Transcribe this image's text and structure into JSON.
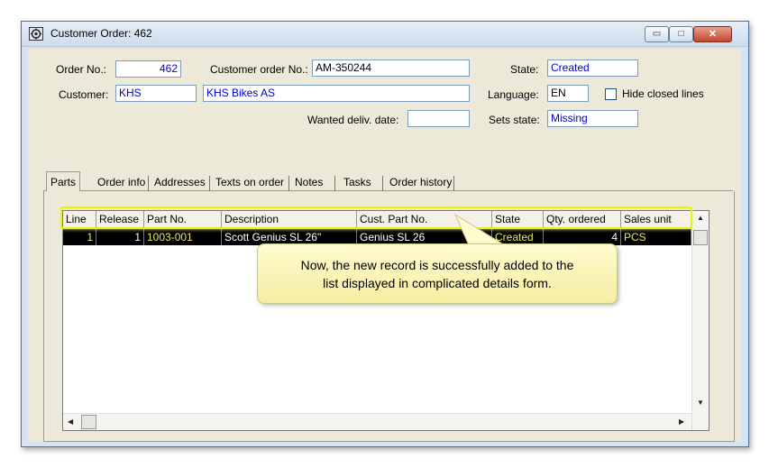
{
  "window": {
    "title": "Customer Order: 462",
    "controls": {
      "minimize": "▭",
      "maximize": "□",
      "close": "✕"
    }
  },
  "header": {
    "order_no_label": "Order No.:",
    "order_no": "462",
    "customer_order_no_label": "Customer order No.:",
    "customer_order_no": "AM-350244",
    "state_label": "State:",
    "state": "Created",
    "customer_label": "Customer:",
    "customer_code": "KHS",
    "customer_name": "KHS Bikes AS",
    "language_label": "Language:",
    "language": "EN",
    "hide_closed_lines_label": "Hide closed lines",
    "hide_closed_lines_checked": false,
    "wanted_deliv_date_label": "Wanted deliv. date:",
    "wanted_deliv_date": "",
    "sets_state_label": "Sets state:",
    "sets_state": "Missing"
  },
  "tabs": [
    {
      "label": "Parts",
      "active": true
    },
    {
      "label": "Order info"
    },
    {
      "label": "Addresses"
    },
    {
      "label": "Texts on order"
    },
    {
      "label": "Notes"
    },
    {
      "label": "Tasks"
    },
    {
      "label": "Order history"
    }
  ],
  "grid": {
    "columns": [
      "Line",
      "Release",
      "Part No.",
      "Description",
      "Cust. Part No.",
      "State",
      "Qty. ordered",
      "Sales unit"
    ],
    "rows": [
      {
        "line": "1",
        "release": "1",
        "part_no": "1003-001",
        "description": "Scott Genius SL 26\"",
        "cust_part_no": "Genius SL 26",
        "state": "Created",
        "qty_ordered": "4",
        "sales_unit": "PCS"
      }
    ]
  },
  "callout": {
    "text_line1": "Now, the new record is successfully added to the",
    "text_line2": "list displayed in complicated details form."
  },
  "colors": {
    "field_value_blue": "#0000c8",
    "selected_row_bg": "#000000",
    "selected_row_text": "#e8e85a",
    "highlight_border": "#e5f01c",
    "callout_bg": "#fff7b8"
  }
}
